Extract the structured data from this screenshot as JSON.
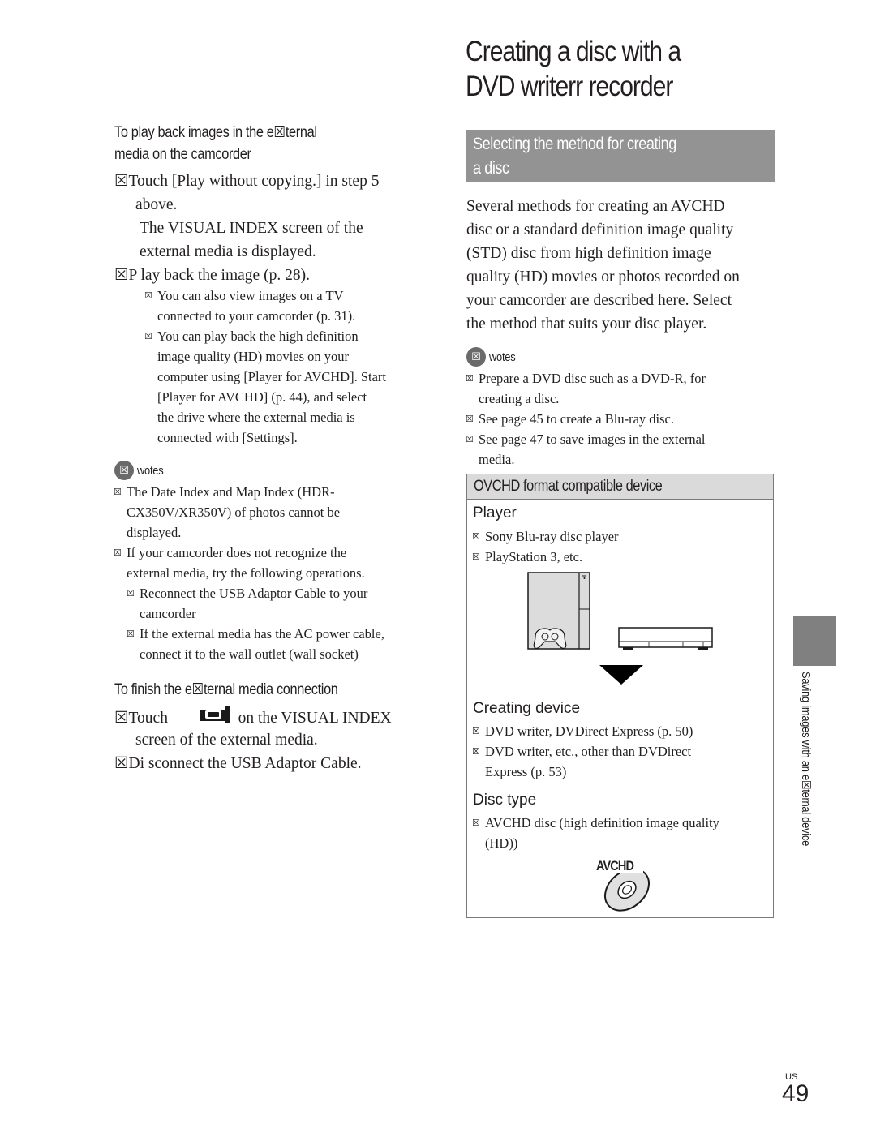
{
  "title": {
    "line1": "Creating a disc with a",
    "line2": "DVD writerr   recorder"
  },
  "left": {
    "playback_heading": {
      "line1": "To play back images in the e☒ternal",
      "line2": "media on the camcorder"
    },
    "steps": [
      {
        "marker": "☒",
        "text": "Touch [Play without copying.] in step 5",
        "cont": "above."
      },
      {
        "marker": "☒",
        "text": "P     lay back the image (p. 28)."
      }
    ],
    "step1_detail": [
      "The VISUAL INDEX screen of the",
      "external media is displayed."
    ],
    "tips": [
      {
        "lines": [
          "You can also view images on a TV",
          "connected to your camcorder (p. 31)."
        ]
      },
      {
        "lines": [
          "You can play back the high definition",
          "image quality (HD) movies on your",
          "computer using [Player for AVCHD]. Start",
          "[Player for AVCHD] (p. 44), and select",
          "the drive where the external media is",
          "connected with [Settings]."
        ]
      }
    ],
    "notes": {
      "icon": "☒",
      "label": "wotes",
      "items": [
        {
          "lines": [
            "The Date Index and Map Index (HDR-",
            "CX350V/XR350V) of photos cannot be",
            "displayed."
          ]
        },
        {
          "lines": [
            "If your camcorder does not recognize the",
            "external media, try the following operations."
          ]
        }
      ],
      "subitems": [
        {
          "lines": [
            "Reconnect the USB Adaptor Cable to your",
            "camcorder"
          ]
        },
        {
          "lines": [
            "If the external media has the AC power cable,",
            "connect it to the wall outlet (wall socket)"
          ]
        }
      ]
    },
    "finish_heading": "To finish the e☒ternal media connection",
    "finish_steps": [
      {
        "marker": "☒",
        "before": "Touch",
        "icon": "camcorder-return-icon",
        "after": "on the VISUAL INDEX",
        "cont": "screen of the external media."
      },
      {
        "marker": "☒",
        "text": "Di     sconnect the USB Adaptor Cable."
      }
    ]
  },
  "right": {
    "section_heading": {
      "line1": "Selecting the method for creating",
      "line2": "a disc"
    },
    "intro": [
      "Several methods for creating an AVCHD",
      "disc or a standard definition image quality",
      "(STD) disc from high definition image",
      "quality (HD) movies or photos recorded on",
      "your camcorder are described here. Select",
      "the method that suits your disc player."
    ],
    "notes": {
      "icon": "☒",
      "label": "wotes",
      "items": [
        {
          "lines": [
            "Prepare a DVD disc such as a DVD-R, for",
            "creating a disc."
          ]
        },
        {
          "lines": [
            "See page 45 to create a Blu-ray disc."
          ]
        },
        {
          "lines": [
            "See page 47 to save images in the external",
            "media."
          ]
        }
      ]
    },
    "device_box": {
      "header": "OVCHD format compatible device",
      "player_label": "Player",
      "player_items": [
        "Sony Blu-ray disc player",
        "PlayStation   3, etc."
      ],
      "creating_label": "Creating device",
      "creating_items": [
        {
          "lines": [
            "DVD writer, DVDirect Express (p. 50)"
          ]
        },
        {
          "lines": [
            "DVD writer, etc., other than DVDirect",
            "Express (p. 53)"
          ]
        }
      ],
      "disc_label": "Disc type",
      "disc_items": [
        {
          "lines": [
            "AVCHD disc (high definition image quality",
            "(HD))"
          ]
        }
      ],
      "logo_text": "AVCHD"
    }
  },
  "bullet_glyph": "☒",
  "side_tab_text": "Saving images with an e☒ternal device",
  "page": {
    "lang": "US",
    "number": "49"
  },
  "colors": {
    "section_bar": "#939393",
    "box_header": "#dadada",
    "side_tab": "#808080"
  }
}
